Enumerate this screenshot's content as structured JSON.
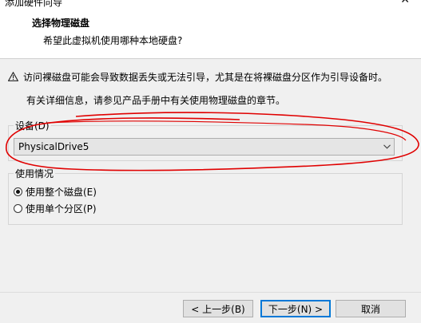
{
  "window": {
    "title": "添加硬件向导",
    "close_glyph": "✕"
  },
  "header": {
    "title": "选择物理磁盘",
    "subtitle": "希望此虚拟机使用哪种本地硬盘?"
  },
  "warning": {
    "icon": "warning-triangle-icon",
    "text": "访问裸磁盘可能会导致数据丢失或无法引导，尤其是在将裸磁盘分区作为引导设备时。",
    "info": "有关详细信息，请参见产品手册中有关使用物理磁盘的章节。"
  },
  "device": {
    "label": "设备(D)",
    "selected": "PhysicalDrive5",
    "arrow_icon": "chevron-down-icon"
  },
  "usage": {
    "label": "使用情况",
    "options": [
      {
        "label": "使用整个磁盘(E)",
        "checked": true
      },
      {
        "label": "使用单个分区(P)",
        "checked": false
      }
    ]
  },
  "buttons": {
    "back": "< 上一步(B)",
    "next": "下一步(N) >",
    "cancel": "取消"
  },
  "colors": {
    "annotation": "#e00000",
    "accent": "#0078d7"
  }
}
